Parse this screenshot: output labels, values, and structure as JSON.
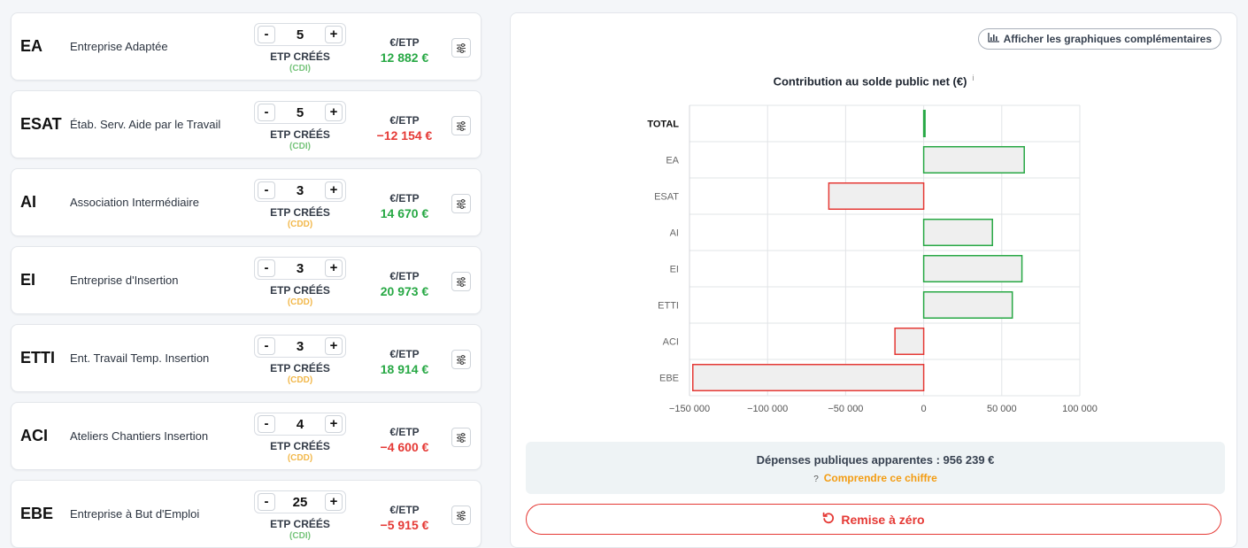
{
  "cards": [
    {
      "code": "EA",
      "label": "Entreprise Adaptée",
      "etp": "5",
      "etp_label": "ETP CRÉÉS",
      "contract": "(CDI)",
      "contract_type": "cdi",
      "eur_label": "€/ETP",
      "eur_value": "12 882 €",
      "sign": "pos"
    },
    {
      "code": "ESAT",
      "label": "Étab. Serv. Aide par le Travail",
      "etp": "5",
      "etp_label": "ETP CRÉÉS",
      "contract": "(CDI)",
      "contract_type": "cdi",
      "eur_label": "€/ETP",
      "eur_value": "−12 154 €",
      "sign": "neg"
    },
    {
      "code": "AI",
      "label": "Association Intermédiaire",
      "etp": "3",
      "etp_label": "ETP CRÉÉS",
      "contract": "(CDD)",
      "contract_type": "cdd",
      "eur_label": "€/ETP",
      "eur_value": "14 670 €",
      "sign": "pos"
    },
    {
      "code": "EI",
      "label": "Entreprise d'Insertion",
      "etp": "3",
      "etp_label": "ETP CRÉÉS",
      "contract": "(CDD)",
      "contract_type": "cdd",
      "eur_label": "€/ETP",
      "eur_value": "20 973 €",
      "sign": "pos"
    },
    {
      "code": "ETTI",
      "label": "Ent. Travail Temp. Insertion",
      "etp": "3",
      "etp_label": "ETP CRÉÉS",
      "contract": "(CDD)",
      "contract_type": "cdd",
      "eur_label": "€/ETP",
      "eur_value": "18 914 €",
      "sign": "pos"
    },
    {
      "code": "ACI",
      "label": "Ateliers Chantiers Insertion",
      "etp": "4",
      "etp_label": "ETP CRÉÉS",
      "contract": "(CDD)",
      "contract_type": "cdd",
      "eur_label": "€/ETP",
      "eur_value": "−4 600 €",
      "sign": "neg"
    },
    {
      "code": "EBE",
      "label": "Entreprise à But d'Emploi",
      "etp": "25",
      "etp_label": "ETP CRÉÉS",
      "contract": "(CDI)",
      "contract_type": "cdi",
      "eur_label": "€/ETP",
      "eur_value": "−5 915 €",
      "sign": "neg"
    }
  ],
  "stepper": {
    "minus": "-",
    "plus": "+"
  },
  "panel": {
    "toggle_label": "Afficher les graphiques complémentaires",
    "chart_title": "Contribution au solde public net (€)",
    "info_mark": "i",
    "spend_text": "Dépenses publiques apparentes : 956 239 €",
    "help_mark": "?",
    "help_link": "Comprendre ce chiffre",
    "reset_label": "Remise à zéro"
  },
  "colors": {
    "positive": "#27a844",
    "negative": "#e53935",
    "bar_fill": "#efefef",
    "accent": "#f39c12"
  },
  "chart_data": {
    "type": "bar",
    "orientation": "horizontal",
    "title": "Contribution au solde public net (€)",
    "categories": [
      "TOTAL",
      "EA",
      "ESAT",
      "AI",
      "EI",
      "ETTI",
      "ACI",
      "EBE"
    ],
    "values": [
      500,
      64410,
      -60770,
      44010,
      62919,
      56742,
      -18400,
      -147875
    ],
    "xlim": [
      -150000,
      100000
    ],
    "xticks": [
      -150000,
      -100000,
      -50000,
      0,
      50000,
      100000
    ],
    "xtick_labels": [
      "−150 000",
      "−100 000",
      "−50 000",
      "0",
      "50 000",
      "100 000"
    ],
    "grid": true,
    "legend": false
  }
}
